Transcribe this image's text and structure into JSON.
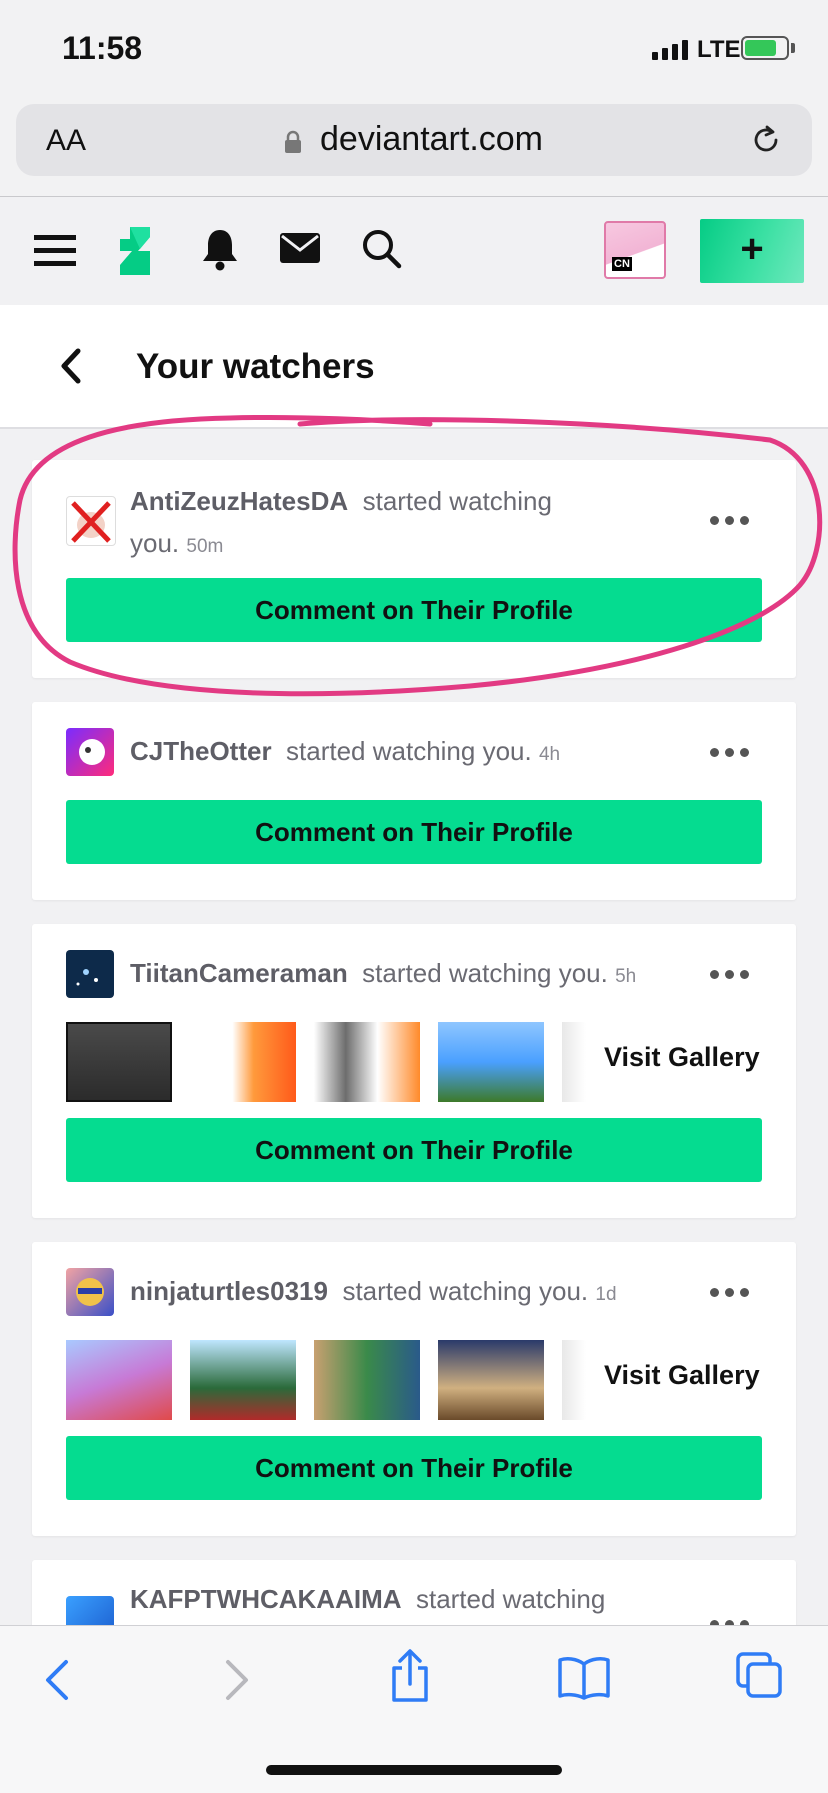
{
  "status": {
    "time": "11:58",
    "network": "LTE"
  },
  "browser": {
    "text_size_label": "AA",
    "url": "deviantart.com"
  },
  "header": {
    "icons": [
      "menu-icon",
      "deviantart-logo",
      "bell-icon",
      "mail-icon",
      "search-icon"
    ],
    "create_label": "+"
  },
  "page": {
    "title": "Your watchers"
  },
  "watchers": [
    {
      "username": "AntiZeuzHatesDA",
      "action": "started watching",
      "action_tail": "you.",
      "time": "50m",
      "button": "Comment on Their Profile"
    },
    {
      "username": "CJTheOtter",
      "action": "started watching you.",
      "time": "4h",
      "button": "Comment on Their Profile"
    },
    {
      "username": "TiitanCameraman",
      "action": "started watching you.",
      "time": "5h",
      "visit_label": "Visit Gallery",
      "button": "Comment on Their Profile"
    },
    {
      "username": "ninjaturtles0319",
      "action": "started watching you.",
      "time": "1d",
      "visit_label": "Visit Gallery",
      "button": "Comment on Their Profile"
    },
    {
      "username": "KAFPTWHCAKAAIMA",
      "action": "started watching"
    }
  ],
  "colors": {
    "accent": "#05dc90",
    "highlight": "#e23a83"
  },
  "toolbar": {
    "icons": [
      "back-icon",
      "forward-icon",
      "share-icon",
      "bookmarks-icon",
      "tabs-icon"
    ]
  }
}
